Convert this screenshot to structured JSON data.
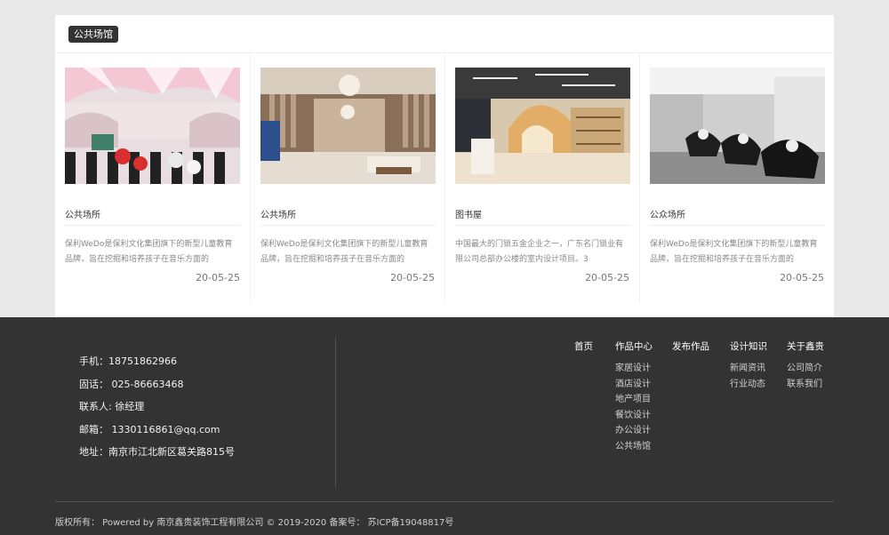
{
  "section": {
    "tag": "公共场馆"
  },
  "cards": [
    {
      "title": "公共场所",
      "desc": "保利WeDo是保利文化集团旗下的新型儿童教育品牌，旨在挖掘和培养孩子在音乐方面的",
      "date": "20-05-25"
    },
    {
      "title": "公共场所",
      "desc": "保利WeDo是保利文化集团旗下的新型儿童教育品牌，旨在挖掘和培养孩子在音乐方面的",
      "date": "20-05-25"
    },
    {
      "title": "图书屋",
      "desc": "中国最大的门锁五金企业之一，广东名门锁业有限公司总部办公楼的室内设计项目。3",
      "date": "20-05-25"
    },
    {
      "title": "公众场所",
      "desc": "保利WeDo是保利文化集团旗下的新型儿童教育品牌，旨在挖掘和培养孩子在音乐方面的",
      "date": "20-05-25"
    }
  ],
  "footer": {
    "phone": "手机：18751862966",
    "tel": "固话： 025-86663468",
    "contact": "联系人: 徐经理",
    "email": "邮箱： 1330116861@qq.com",
    "address": "地址：南京市江北新区葛关路815号",
    "nav": [
      {
        "head": "首页",
        "items": []
      },
      {
        "head": "作品中心",
        "items": [
          "家居设计",
          "酒店设计",
          "地产项目",
          "餐饮设计",
          "办公设计",
          "公共场馆"
        ]
      },
      {
        "head": "发布作品",
        "items": []
      },
      {
        "head": "设计知识",
        "items": [
          "新闻资讯",
          "行业动态"
        ]
      },
      {
        "head": "关于鑫贵",
        "items": [
          "公司简介",
          "联系我们"
        ]
      }
    ],
    "copyright": "版权所有： Powered by 南京鑫贵装饰工程有限公司 © 2019-2020 备案号： 苏ICP备19048817号"
  }
}
